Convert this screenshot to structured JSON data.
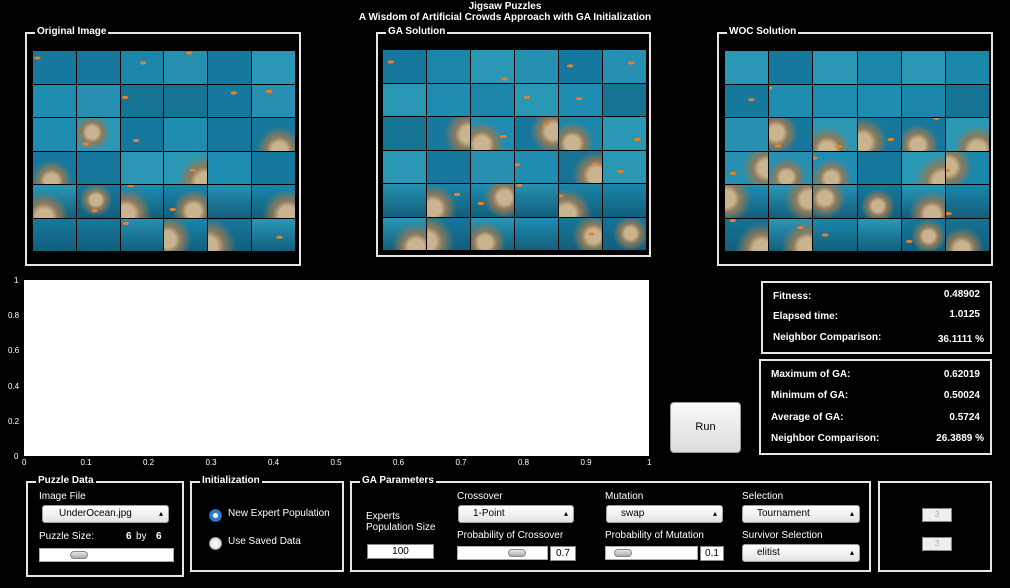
{
  "window": {
    "title_line1": "Jigsaw Puzzles",
    "title_line2": "A Wisdom of Artificial Crowds Approach with GA Initialization"
  },
  "panels": {
    "original": "Original Image",
    "ga": "GA Solution",
    "woc": "WOC Solution"
  },
  "plot": {
    "yticks": [
      "1",
      "0.8",
      "0.6",
      "0.4",
      "0.2",
      "0"
    ],
    "xticks": [
      "0",
      "0.1",
      "0.2",
      "0.3",
      "0.4",
      "0.5",
      "0.6",
      "0.7",
      "0.8",
      "0.9",
      "1"
    ]
  },
  "stats_top": {
    "fitness_label": "Fitness:",
    "fitness_value": "0.48902",
    "elapsed_label": "Elapsed time:",
    "elapsed_value": "1.0125",
    "neighbor_label": "Neighbor Comparison:",
    "neighbor_value": "36.1111 %"
  },
  "stats_bottom": {
    "max_label": "Maximum of GA:",
    "max_value": "0.62019",
    "min_label": "Minimum of GA:",
    "min_value": "0.50024",
    "avg_label": "Average of GA:",
    "avg_value": "0.5724",
    "neighbor_label": "Neighbor Comparison:",
    "neighbor_value": "26.3889 %"
  },
  "run_button": "Run",
  "puzzle_data": {
    "legend": "Puzzle Data",
    "image_file_label": "Image File",
    "image_file_value": "UnderOcean.jpg",
    "size_label": "Puzzle Size:",
    "rows": "6",
    "by": "by",
    "cols": "6",
    "size_slider_fraction": 0.2
  },
  "initialization": {
    "legend": "Initialization",
    "option_new": "New Expert Population",
    "option_saved": "Use Saved Data",
    "selected": "new"
  },
  "ga_parameters": {
    "legend": "GA Parameters",
    "experts_label_1": "Experts",
    "experts_label_2": "Population Size",
    "experts_value": "100",
    "crossover_label": "Crossover",
    "crossover_value": "1-Point",
    "prob_crossover_label": "Probability of Crossover",
    "prob_crossover_value": "0.7",
    "mutation_label": "Mutation",
    "mutation_value": "swap",
    "prob_mutation_label": "Probability of Mutation",
    "prob_mutation_value": "0.1",
    "selection_label": "Selection",
    "selection_value": "Tournament",
    "survivor_label": "Survivor Selection",
    "survivor_value": "elitist"
  },
  "extra_panel": {
    "field1": "3",
    "field2": "3"
  },
  "colors": {
    "panel_border": "#e6e6e6",
    "ocean": "#1e84a6",
    "fish": "#e8822a",
    "coral": "#c9b48f"
  }
}
